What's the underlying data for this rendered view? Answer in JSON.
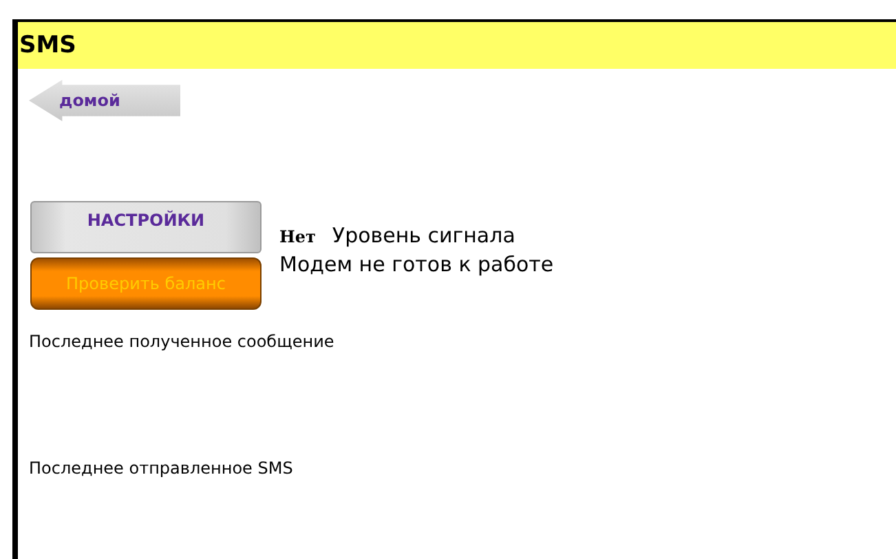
{
  "header": {
    "title": "SMS"
  },
  "back_button": {
    "label": "домой"
  },
  "settings_button": {
    "label": "НАСТРОЙКИ"
  },
  "balance_button": {
    "label": "Проверить баланс"
  },
  "signal": {
    "value": "Нет",
    "label": "Уровень сигнала"
  },
  "modem_status": "Модем не готов к работе",
  "last_received_label": "Последнее полученное сообщение",
  "last_sent_label": "Последнее отправленное SMS"
}
